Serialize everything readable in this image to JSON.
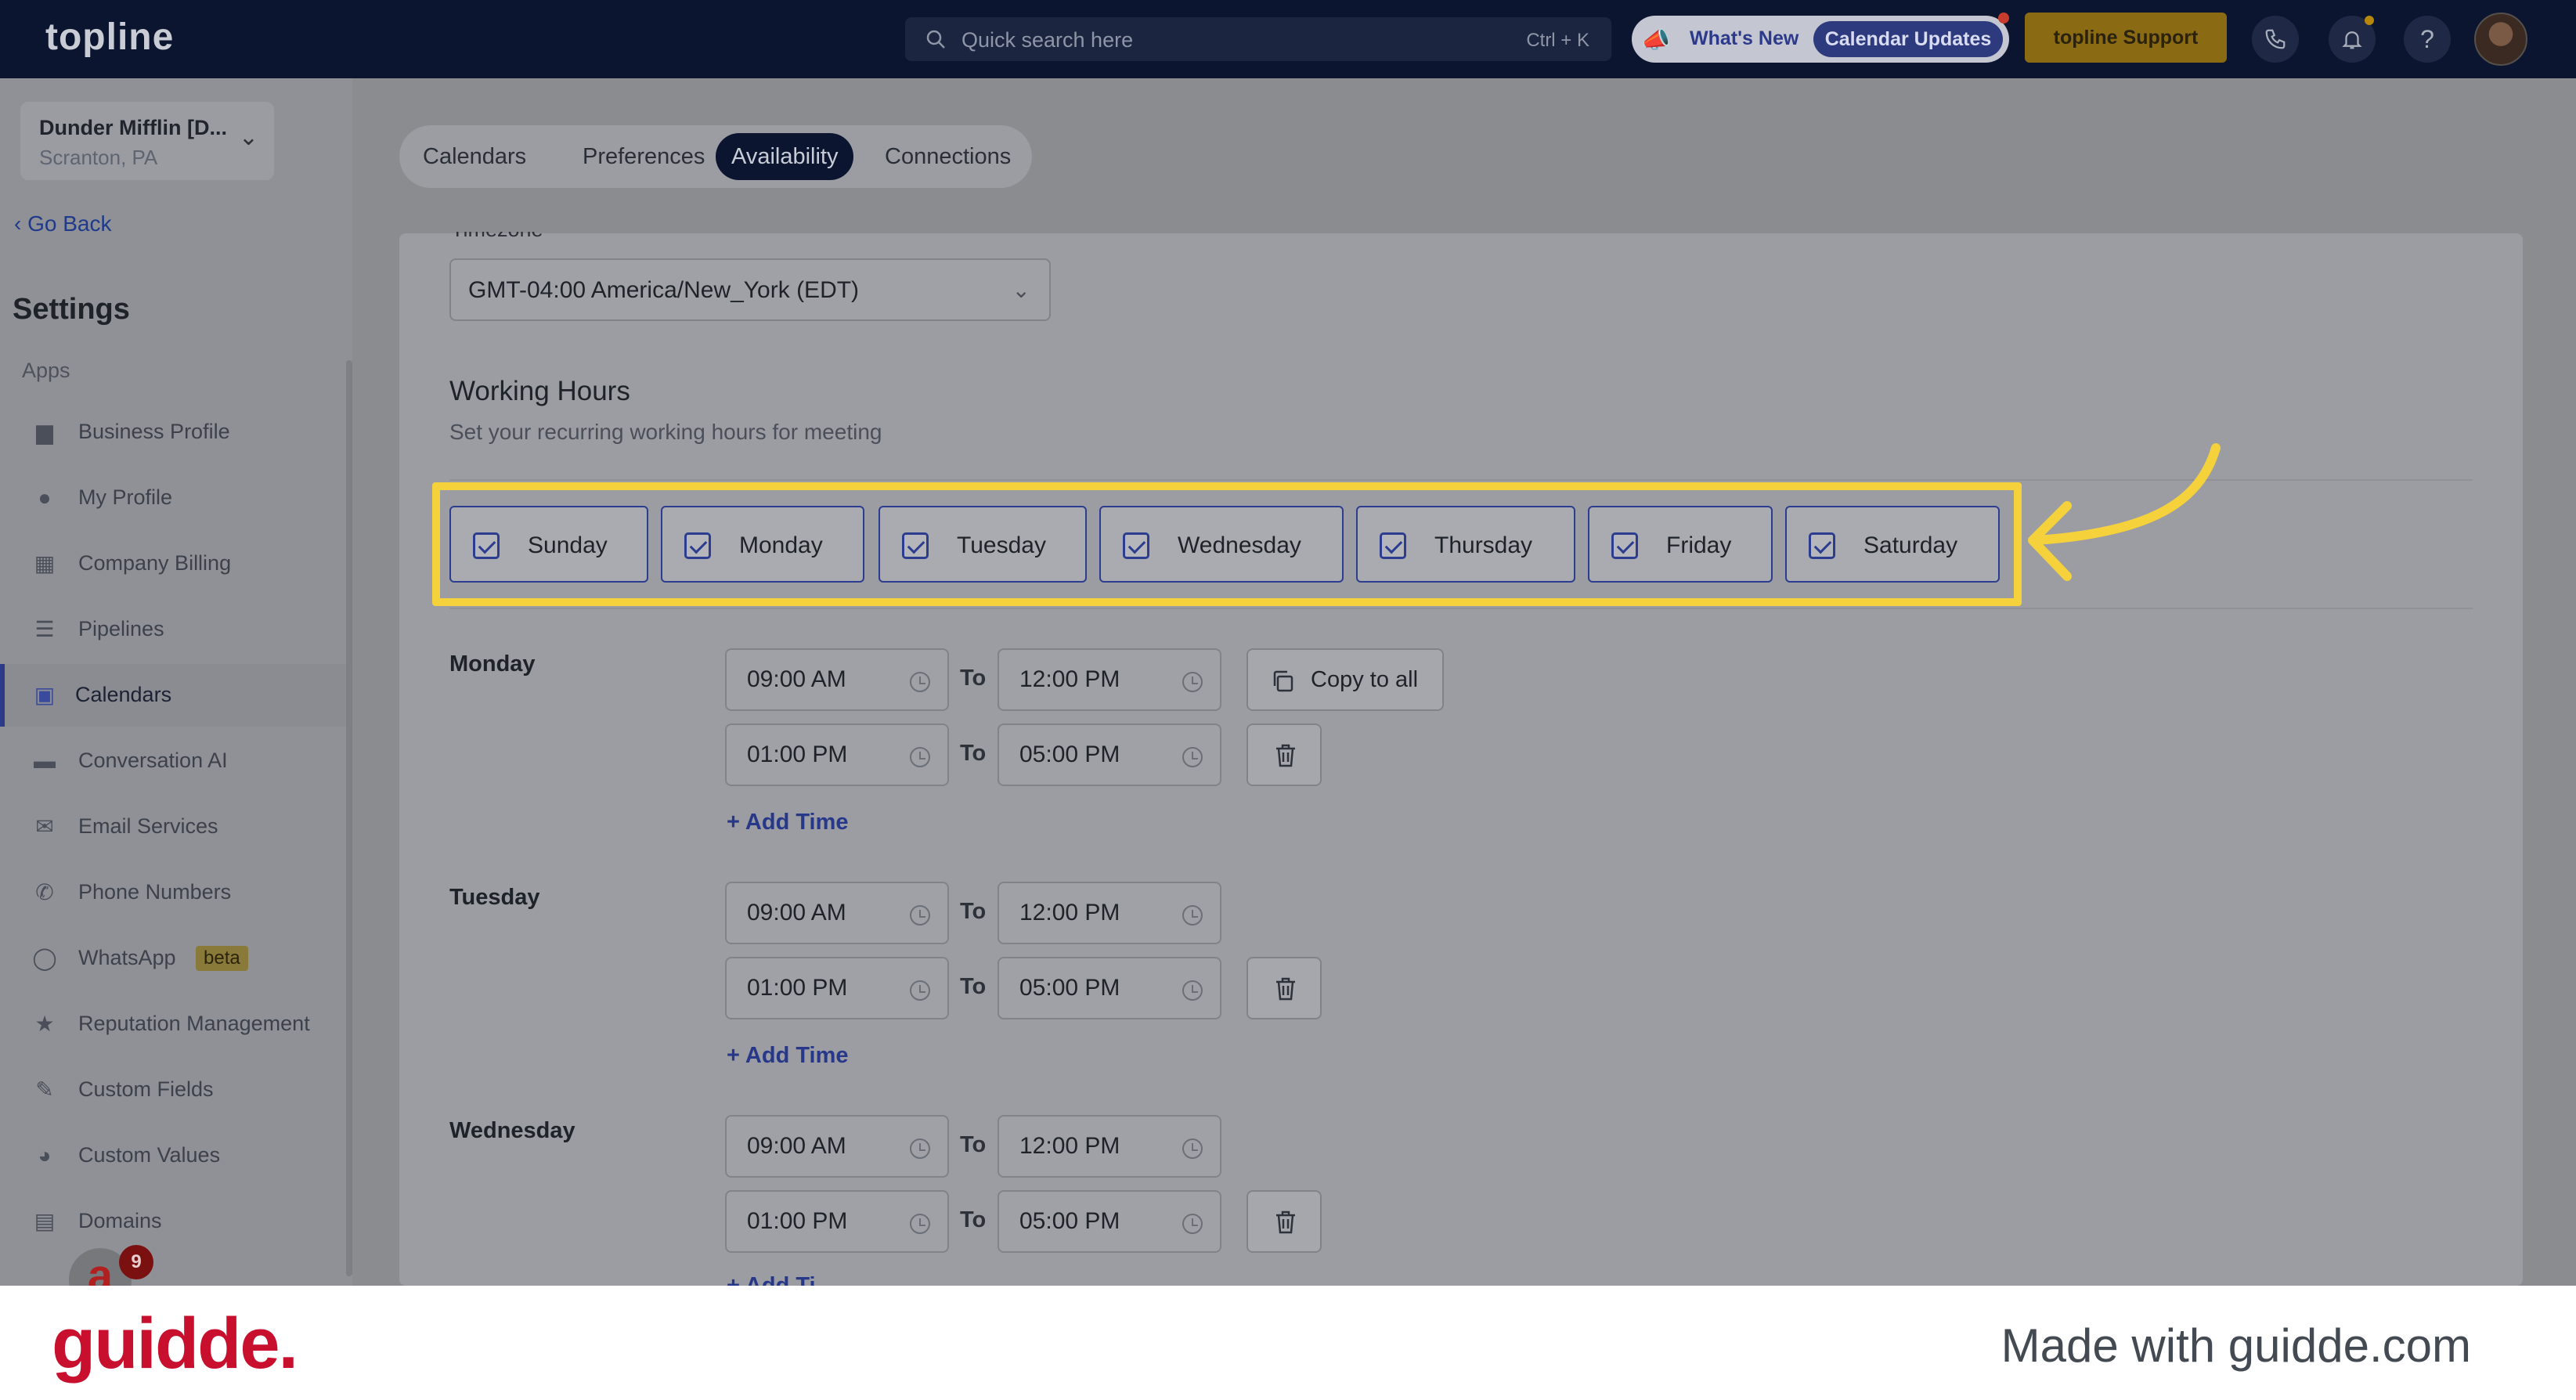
{
  "topbar": {
    "logo": "topline",
    "search_placeholder": "Quick search here",
    "search_shortcut": "Ctrl + K",
    "whats_new": "What's New",
    "calendar_updates": "Calendar Updates",
    "support": "topline Support",
    "help": "?"
  },
  "sidebar": {
    "location_name": "Dunder Mifflin [D...",
    "location_city": "Scranton, PA",
    "go_back": "Go Back",
    "title": "Settings",
    "section": "Apps",
    "items": [
      {
        "label": "Business Profile",
        "icon": "briefcase-icon"
      },
      {
        "label": "My Profile",
        "icon": "user-icon"
      },
      {
        "label": "Company Billing",
        "icon": "grid-icon"
      },
      {
        "label": "Pipelines",
        "icon": "filter-icon"
      },
      {
        "label": "Calendars",
        "icon": "calendar-icon",
        "active": true
      },
      {
        "label": "Conversation AI",
        "icon": "chat-icon"
      },
      {
        "label": "Email Services",
        "icon": "mail-icon"
      },
      {
        "label": "Phone Numbers",
        "icon": "phone-icon"
      },
      {
        "label": "WhatsApp",
        "icon": "whatsapp-icon",
        "badge": "beta"
      },
      {
        "label": "Reputation Management",
        "icon": "star-icon"
      },
      {
        "label": "Custom Fields",
        "icon": "edit-icon"
      },
      {
        "label": "Custom Values",
        "icon": "pie-icon"
      },
      {
        "label": "Domains",
        "icon": "window-icon"
      }
    ],
    "chat_badge": "9"
  },
  "tabs": [
    {
      "label": "Calendars"
    },
    {
      "label": "Preferences"
    },
    {
      "label": "Availability",
      "active": true
    },
    {
      "label": "Connections"
    }
  ],
  "availability": {
    "timezone_label": "Timezone",
    "timezone_value": "GMT-04:00 America/New_York (EDT)",
    "working_hours_title": "Working Hours",
    "working_hours_subtitle": "Set your recurring working hours for meeting",
    "days": [
      "Sunday",
      "Monday",
      "Tuesday",
      "Wednesday",
      "Thursday",
      "Friday",
      "Saturday"
    ],
    "to_label": "To",
    "copy_to_all": "Copy to all",
    "add_time": "+ Add Time",
    "schedule": [
      {
        "day": "Monday",
        "slots": [
          {
            "from": "09:00 AM",
            "to": "12:00 PM"
          },
          {
            "from": "01:00 PM",
            "to": "05:00 PM"
          }
        ]
      },
      {
        "day": "Tuesday",
        "slots": [
          {
            "from": "09:00 AM",
            "to": "12:00 PM"
          },
          {
            "from": "01:00 PM",
            "to": "05:00 PM"
          }
        ]
      },
      {
        "day": "Wednesday",
        "slots": [
          {
            "from": "09:00 AM",
            "to": "12:00 PM"
          },
          {
            "from": "01:00 PM",
            "to": "05:00 PM"
          }
        ]
      }
    ],
    "truncated_add_time": "+ Add Ti"
  },
  "footer": {
    "brand": "guidde.",
    "made_with": "Made with guidde.com"
  },
  "colors": {
    "topbar": "#0b1530",
    "accent": "#2c3d8f",
    "highlight": "#f5d23c",
    "brand": "#c8102e"
  }
}
